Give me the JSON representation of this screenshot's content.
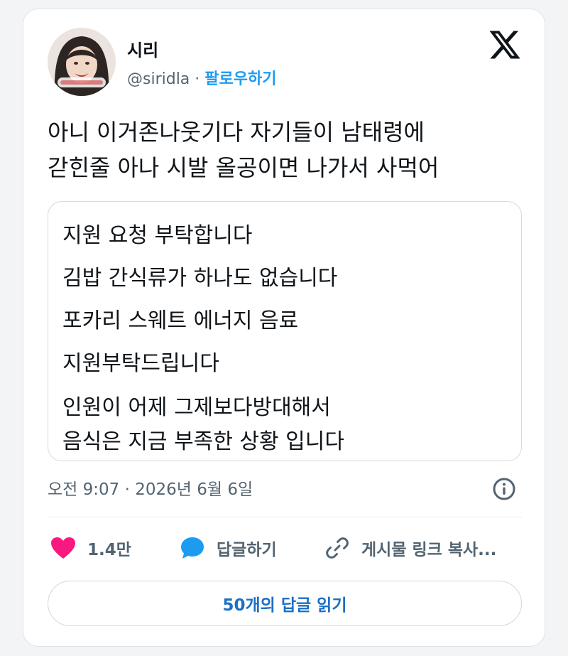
{
  "author": {
    "name": "시리",
    "handle": "@siridla",
    "separator": "·",
    "follow_label": "팔로우하기"
  },
  "tweet": {
    "lines": [
      "아니 이거존나웃기다 자기들이 남태령에",
      "갇힌줄 아나 시발 올공이면 나가서 사먹어"
    ]
  },
  "attached_text": {
    "lines": [
      "지원 요청 부탁합니다",
      "김밥 간식류가 하나도 없습니다",
      "포카리 스웨트 에너지  음료",
      "지원부탁드립니다",
      "인원이 어제 그제보다방대해서",
      "음식은 지금 부족한 상황 입니다"
    ]
  },
  "meta": {
    "timestamp": "오전 9:07 · 2026년 6월 6일"
  },
  "actions": {
    "like_count": "1.4만",
    "reply_label": "답글하기",
    "copy_link_label": "게시물 링크 복사..."
  },
  "read_replies_label": "50개의 답글 읽기",
  "colors": {
    "accent": "#1d9bf0",
    "like": "#f91880",
    "text": "#0f1419",
    "muted": "#536471"
  },
  "icons": [
    "x-logo-icon",
    "info-icon",
    "heart-icon",
    "reply-bubble-icon",
    "link-icon"
  ]
}
